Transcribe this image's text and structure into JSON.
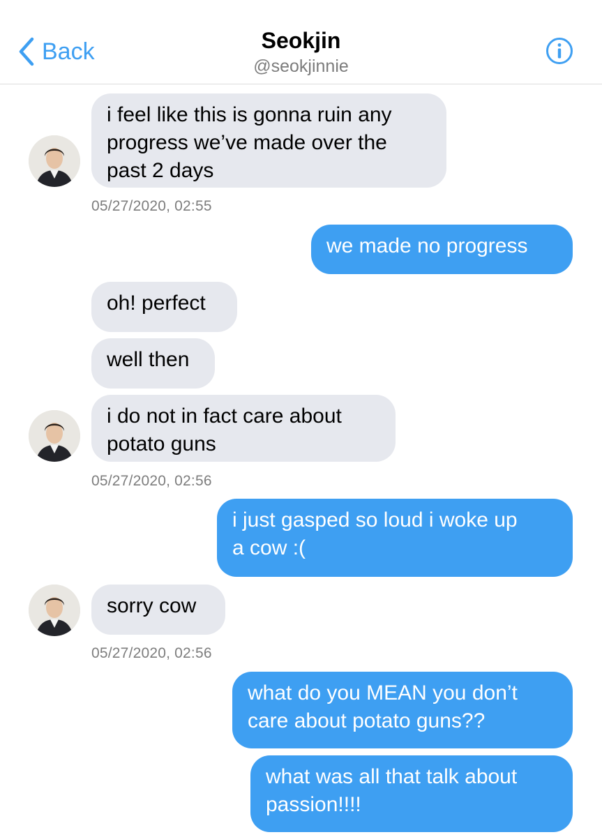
{
  "header": {
    "back_label": "Back",
    "title": "Seokjin",
    "handle": "@seokjinnie",
    "icons": {
      "back": "chevron-left-icon",
      "info": "info-icon"
    },
    "accent_color": "#3e9ff2"
  },
  "messages": [
    {
      "from": "them",
      "lines": [
        "i feel like this is gonna ruin any",
        "progress we’ve made over the",
        "past 2 days"
      ]
    },
    {
      "timestamp": "05/27/2020, 02:55"
    },
    {
      "from": "me",
      "lines": [
        "we made no progress"
      ]
    },
    {
      "from": "them",
      "lines": [
        "oh! perfect"
      ]
    },
    {
      "from": "them",
      "lines": [
        "well then"
      ]
    },
    {
      "from": "them",
      "lines": [
        "i do not in fact care about",
        "potato guns"
      ]
    },
    {
      "timestamp": "05/27/2020, 02:56"
    },
    {
      "from": "me",
      "lines": [
        "i just gasped so loud i woke up",
        "a cow :("
      ]
    },
    {
      "from": "them",
      "lines": [
        "sorry cow"
      ]
    },
    {
      "timestamp": "05/27/2020, 02:56"
    },
    {
      "from": "me",
      "lines": [
        "what do you MEAN you don’t",
        "care about potato guns??"
      ]
    },
    {
      "from": "me",
      "lines": [
        "what was all that talk about",
        "passion!!!!"
      ]
    }
  ],
  "colors": {
    "incoming_bubble": "#e6e8ee",
    "outgoing_bubble": "#3e9ff2",
    "timestamp": "#7d7d7d"
  }
}
